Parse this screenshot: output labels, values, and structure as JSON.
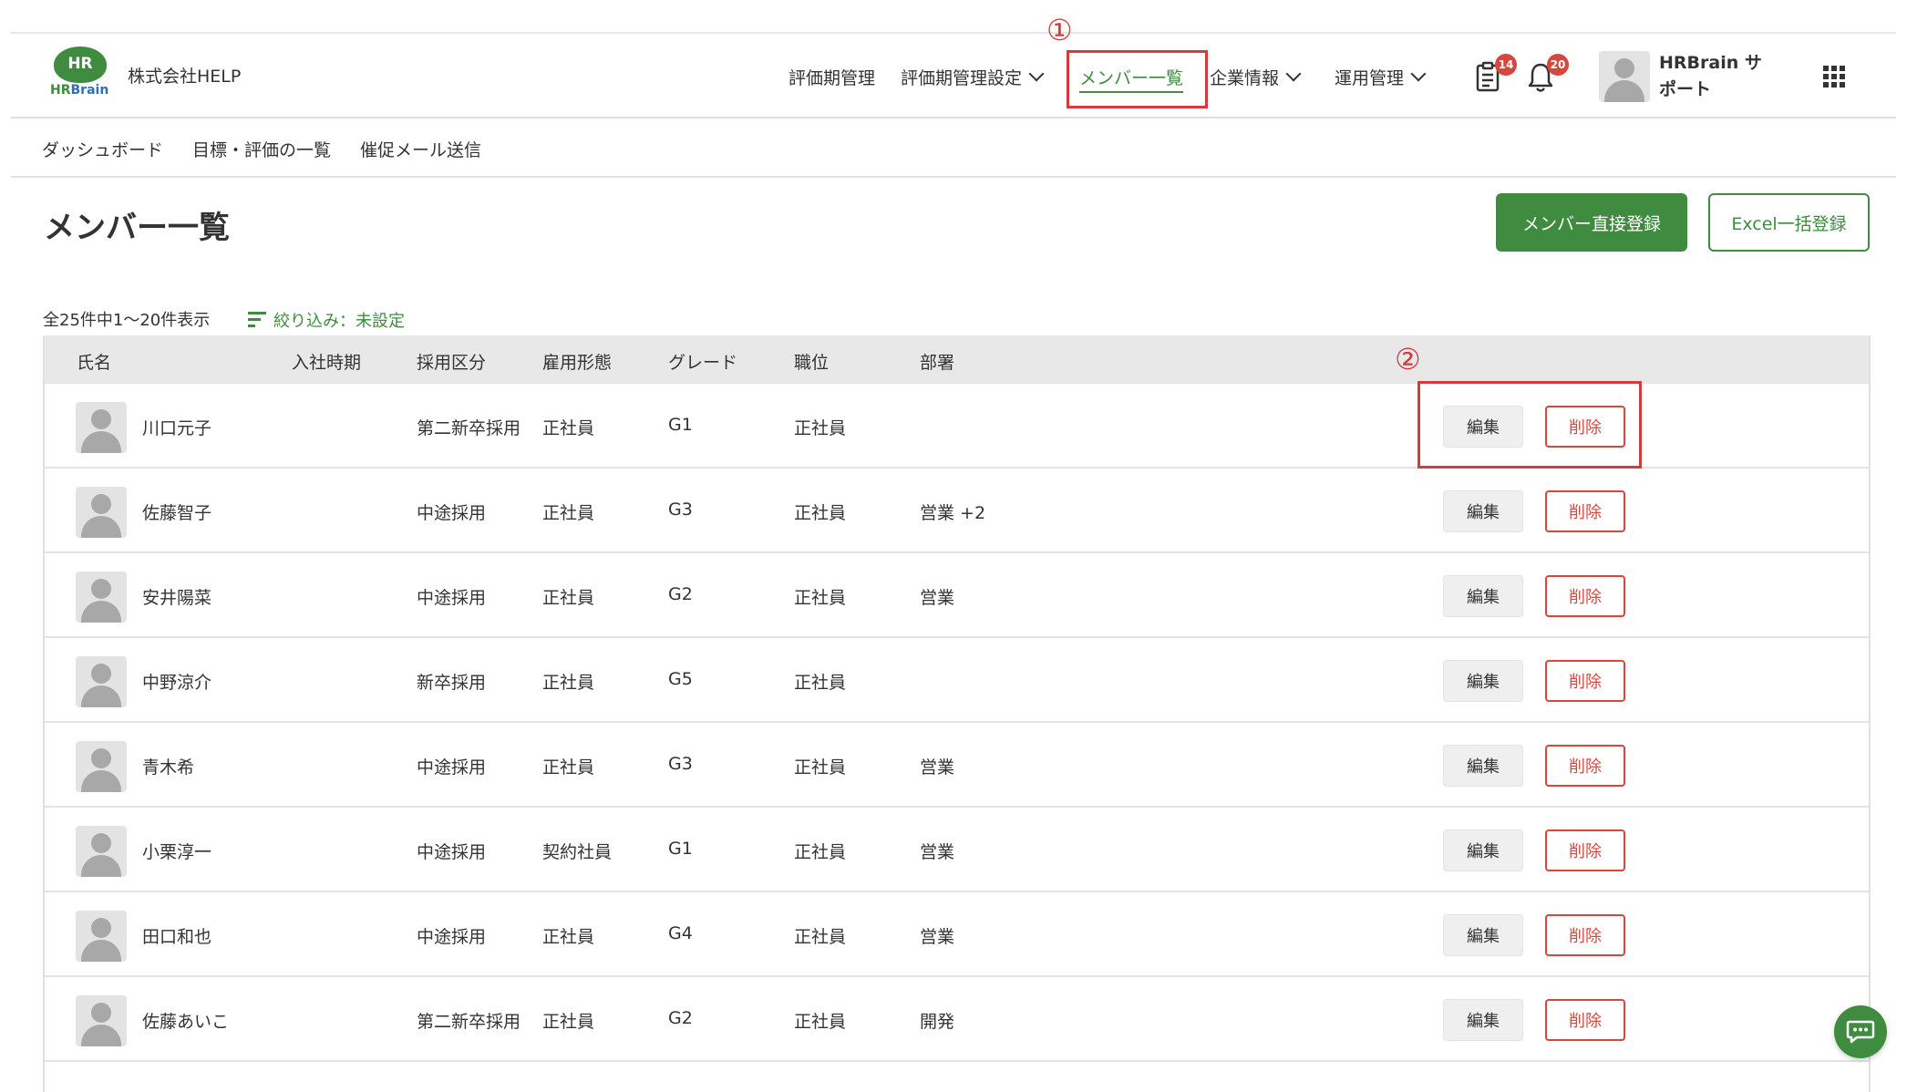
{
  "header": {
    "logo_main": "HR",
    "logo_sub_1": "HR",
    "logo_sub_2": "Brain",
    "company": "株式会社HELP",
    "nav": [
      {
        "label": "評価期管理"
      },
      {
        "label": "評価期管理設定"
      },
      {
        "label": "メンバー一覧",
        "active": true
      },
      {
        "label": "企業情報"
      },
      {
        "label": "運用管理"
      }
    ],
    "clipboard_badge": "14",
    "bell_badge": "20",
    "user_name": "HRBrain サポート"
  },
  "annotations": {
    "marker1": "①",
    "marker2": "②"
  },
  "subnav": [
    {
      "label": "ダッシュボード"
    },
    {
      "label": "目標・評価の一覧"
    },
    {
      "label": "催促メール送信"
    }
  ],
  "page": {
    "title": "メンバー一覧",
    "primary_button": "メンバー直接登録",
    "excel_button": "Excel一括登録",
    "count": "全25件中1〜20件表示",
    "filter": "絞り込み：未設定"
  },
  "table": {
    "headers": [
      "氏名",
      "入社時期",
      "採用区分",
      "雇用形態",
      "グレード",
      "職位",
      "部署"
    ],
    "edit_label": "編集",
    "delete_label": "削除",
    "rows": [
      {
        "name": "川口元子",
        "joined": "",
        "category": "第二新卒採用",
        "employment": "正社員",
        "grade": "G1",
        "position": "正社員",
        "department": ""
      },
      {
        "name": "佐藤智子",
        "joined": "",
        "category": "中途採用",
        "employment": "正社員",
        "grade": "G3",
        "position": "正社員",
        "department": "営業  +2"
      },
      {
        "name": "安井陽菜",
        "joined": "",
        "category": "中途採用",
        "employment": "正社員",
        "grade": "G2",
        "position": "正社員",
        "department": "営業"
      },
      {
        "name": "中野涼介",
        "joined": "",
        "category": "新卒採用",
        "employment": "正社員",
        "grade": "G5",
        "position": "正社員",
        "department": ""
      },
      {
        "name": "青木希",
        "joined": "",
        "category": "中途採用",
        "employment": "正社員",
        "grade": "G3",
        "position": "正社員",
        "department": "営業"
      },
      {
        "name": "小栗淳一",
        "joined": "",
        "category": "中途採用",
        "employment": "契約社員",
        "grade": "G1",
        "position": "正社員",
        "department": "営業"
      },
      {
        "name": "田口和也",
        "joined": "",
        "category": "中途採用",
        "employment": "正社員",
        "grade": "G4",
        "position": "正社員",
        "department": "営業"
      },
      {
        "name": "佐藤あいこ",
        "joined": "",
        "category": "第二新卒採用",
        "employment": "正社員",
        "grade": "G2",
        "position": "正社員",
        "department": "開発"
      }
    ]
  },
  "colors": {
    "brand_green": "#3f8b3f",
    "danger_red": "#d8473e",
    "annotation_red": "#d63a3a"
  }
}
